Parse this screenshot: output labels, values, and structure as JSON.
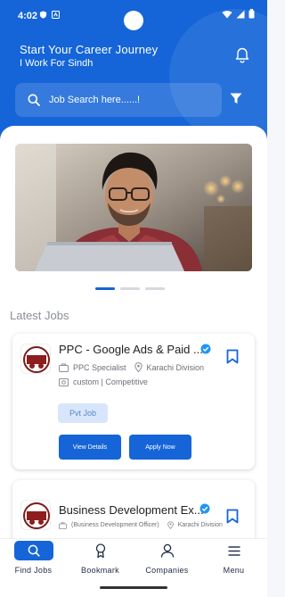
{
  "status_bar": {
    "time": "4:02"
  },
  "header": {
    "greeting": "Start Your Career Journey",
    "subtitle": "I Work For Sindh",
    "search_placeholder": "Job Search here......!"
  },
  "banner": {
    "active_slide": 1,
    "slide_count": 3
  },
  "latest_jobs": {
    "title": "Latest Jobs",
    "jobs": [
      {
        "title": "PPC - Google Ads & Paid ...",
        "role": "PPC Specialist",
        "location": "Karachi Division",
        "salary": "custom | Competitive",
        "type": "Pvt Job",
        "view_label": "View Details",
        "apply_label": "Apply Now"
      },
      {
        "title": "Business Development Ex...",
        "role": "(Business Development Officer)",
        "location": "Karachi Division"
      }
    ]
  },
  "bottom_nav": [
    {
      "label": "Find Jobs",
      "icon": "search-icon",
      "active": true
    },
    {
      "label": "Bookmark",
      "icon": "bookmark-icon",
      "active": false
    },
    {
      "label": "Companies",
      "icon": "person-icon",
      "active": false
    },
    {
      "label": "Menu",
      "icon": "menu-icon",
      "active": false
    }
  ],
  "colors": {
    "primary": "#1565d8",
    "tag_bg": "#d8e6fb",
    "verified": "#2196f3"
  }
}
